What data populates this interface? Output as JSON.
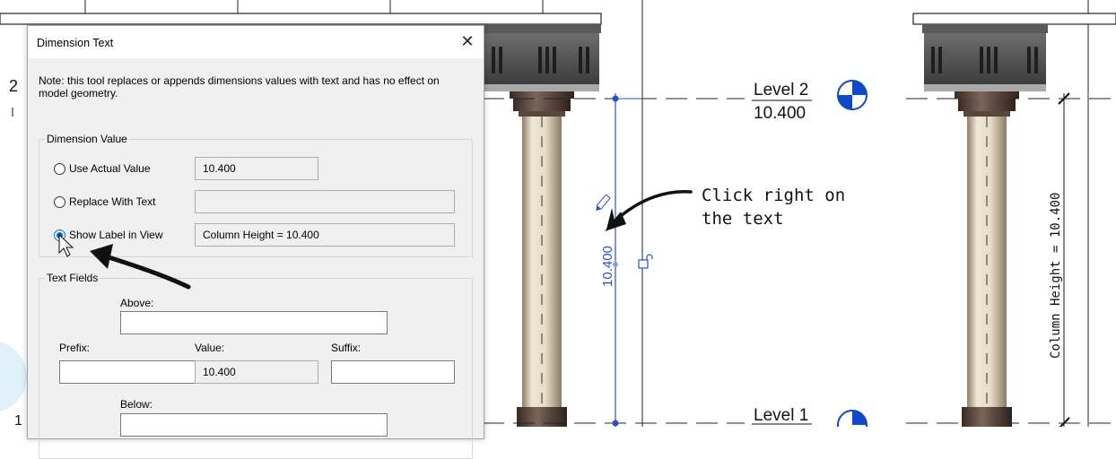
{
  "dialog": {
    "title": "Dimension Text",
    "close_glyph": "✕",
    "note": "Note: this tool replaces or appends dimensions values with text and has no effect on model geometry.",
    "dimension_value": {
      "group_label": "Dimension Value",
      "options": [
        {
          "label": "Use Actual Value",
          "value": "10.400",
          "checked": false
        },
        {
          "label": "Replace With Text",
          "value": "",
          "checked": false
        },
        {
          "label": "Show Label in View",
          "value": "Column Height = 10.400",
          "checked": true
        }
      ]
    },
    "text_fields": {
      "group_label": "Text Fields",
      "above_label": "Above:",
      "above_value": "",
      "prefix_label": "Prefix:",
      "prefix_value": "",
      "value_label": "Value:",
      "value_value": "10.400",
      "suffix_label": "Suffix:",
      "suffix_value": "",
      "below_label": "Below:",
      "below_value": ""
    }
  },
  "drawing": {
    "level_2_name": "Level 2",
    "level_2_elevation": "10.400",
    "level_1_name": "Level 1",
    "dimension_value_text": "10.400",
    "column_label_text": "Column Height = 10.400",
    "left_margin_marker": "2",
    "left_bottom_marker": "1"
  },
  "annotation": {
    "callout_line1": "Click right on",
    "callout_line2": "the text"
  },
  "colors": {
    "dimension_blue": "#2c4fc9",
    "level_head_blue": "#1148c8",
    "column_shaft": "#e8e0cc",
    "column_dark": "#4d3a33",
    "accent_radio": "#0a68c4"
  }
}
